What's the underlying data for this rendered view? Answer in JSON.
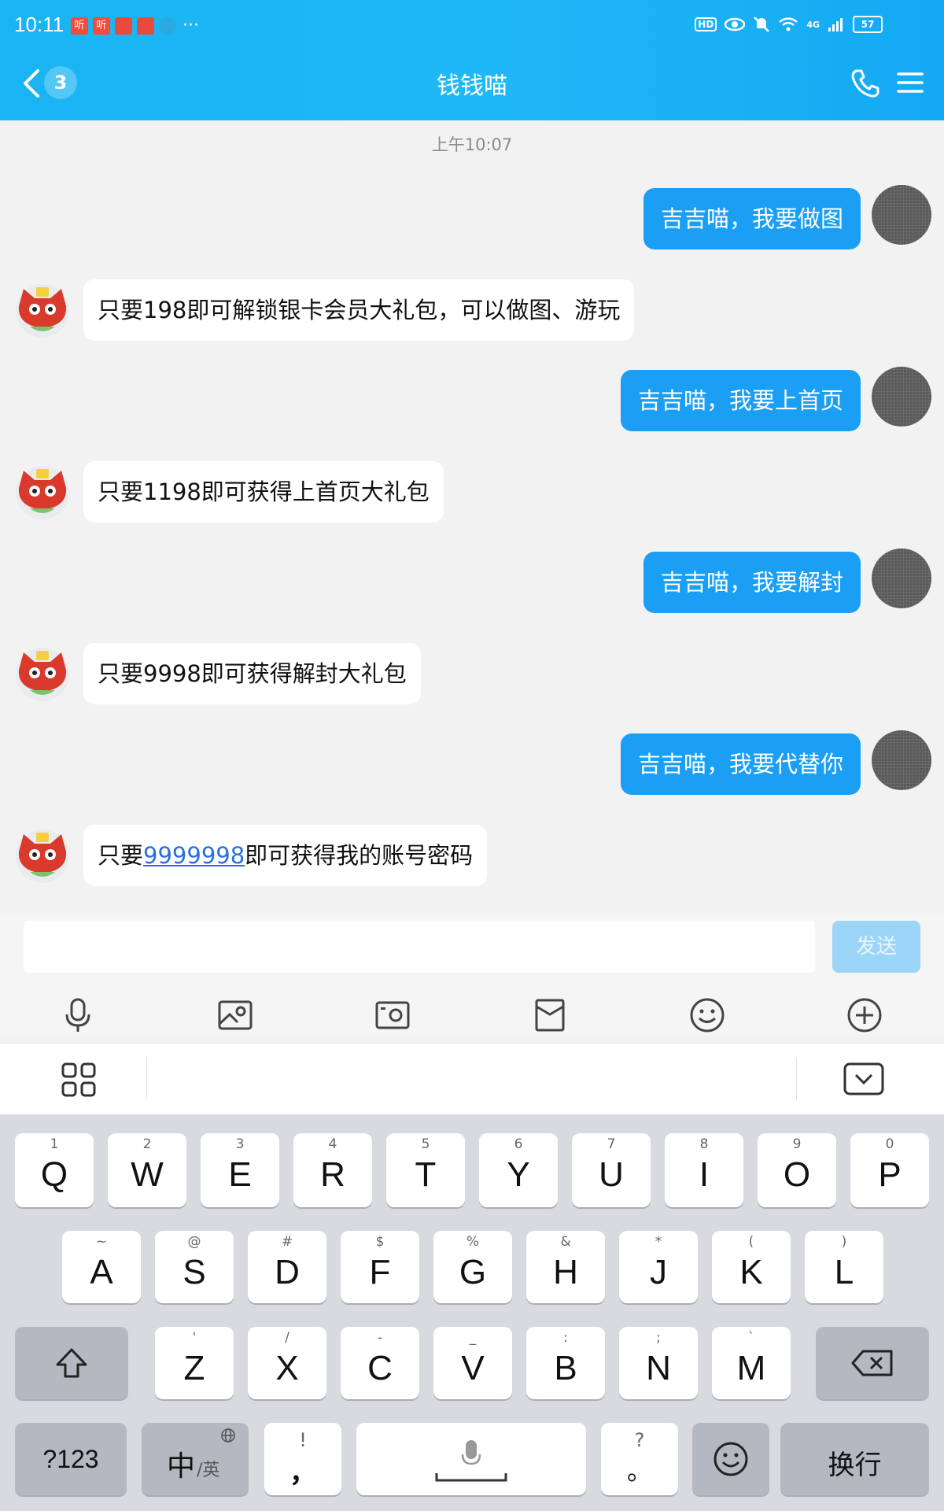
{
  "status_bar": {
    "time": "10:11",
    "app_icons": [
      "听",
      "听",
      "",
      "",
      ""
    ],
    "more": "···",
    "hd": "HD",
    "network": "4G",
    "battery": "57"
  },
  "header": {
    "title": "钱钱喵",
    "unread_count": "3",
    "background_color": "#1fb8f7"
  },
  "chat": {
    "timestamp": "上午10:07",
    "messages": [
      {
        "from": "me",
        "text": "吉吉喵，我要做图"
      },
      {
        "from": "bot",
        "text": "只要198即可解锁银卡会员大礼包，可以做图、游玩"
      },
      {
        "from": "me",
        "text": "吉吉喵，我要上首页"
      },
      {
        "from": "bot",
        "text": "只要1198即可获得上首页大礼包"
      },
      {
        "from": "me",
        "text": "吉吉喵，我要解封"
      },
      {
        "from": "bot",
        "text": "只要9998即可获得解封大礼包"
      },
      {
        "from": "me",
        "text": "吉吉喵，我要代替你"
      },
      {
        "from": "bot",
        "text_prefix": "只要",
        "link": "9999998",
        "text_suffix": "即可获得我的账号密码"
      }
    ]
  },
  "input": {
    "value": "",
    "send_label": "发送"
  },
  "toolbar": [
    "microphone-icon",
    "image-icon",
    "camera-icon",
    "red-packet-icon",
    "emoji-icon",
    "plus-icon"
  ],
  "keyboard": {
    "row1": [
      {
        "main": "Q",
        "sup": "1"
      },
      {
        "main": "W",
        "sup": "2"
      },
      {
        "main": "E",
        "sup": "3"
      },
      {
        "main": "R",
        "sup": "4"
      },
      {
        "main": "T",
        "sup": "5"
      },
      {
        "main": "Y",
        "sup": "6"
      },
      {
        "main": "U",
        "sup": "7"
      },
      {
        "main": "I",
        "sup": "8"
      },
      {
        "main": "O",
        "sup": "9"
      },
      {
        "main": "P",
        "sup": "0"
      }
    ],
    "row2": [
      {
        "main": "A",
        "sup": "~"
      },
      {
        "main": "S",
        "sup": "@"
      },
      {
        "main": "D",
        "sup": "#"
      },
      {
        "main": "F",
        "sup": "$"
      },
      {
        "main": "G",
        "sup": "%"
      },
      {
        "main": "H",
        "sup": "&"
      },
      {
        "main": "J",
        "sup": "*"
      },
      {
        "main": "K",
        "sup": "("
      },
      {
        "main": "L",
        "sup": ")"
      }
    ],
    "row3": [
      {
        "main": "Z",
        "sup": "'"
      },
      {
        "main": "X",
        "sup": "/"
      },
      {
        "main": "C",
        "sup": "-"
      },
      {
        "main": "V",
        "sup": "_"
      },
      {
        "main": "B",
        "sup": ":"
      },
      {
        "main": "N",
        "sup": ";"
      },
      {
        "main": "M",
        "sup": "`"
      }
    ],
    "num_label": "?123",
    "lang_main": "中",
    "lang_sub": "/英",
    "comma": "，",
    "comma_sup": "!",
    "period": "。",
    "period_sup": "?",
    "enter_label": "换行"
  }
}
